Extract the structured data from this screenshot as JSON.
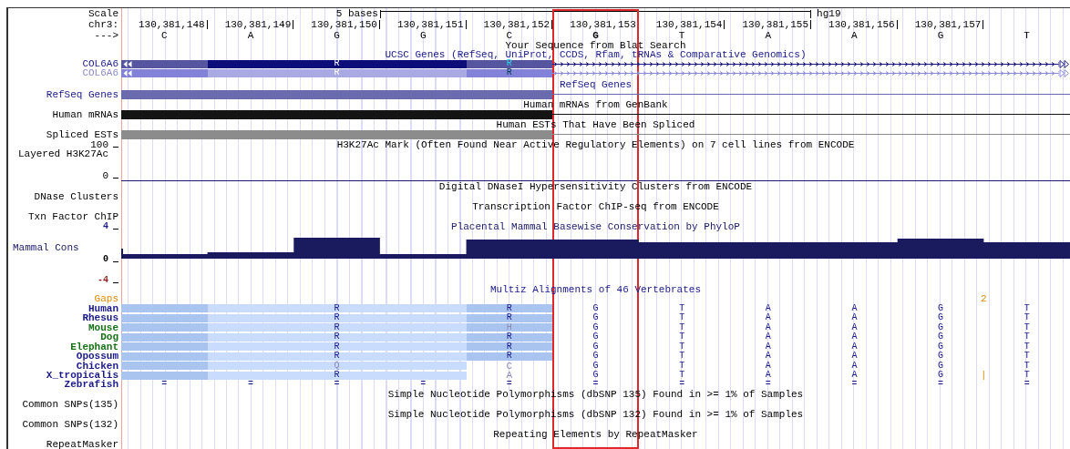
{
  "ruler": {
    "scale_label": "Scale",
    "scale_text": "5 bases",
    "assembly": "hg19",
    "chrom_label": "chr3:",
    "strand_label": "--->",
    "positions": [
      "130,381,148",
      "130,381,149",
      "130,381,150",
      "130,381,151",
      "130,381,152",
      "130,381,153",
      "130,381,154",
      "130,381,155",
      "130,381,156",
      "130,381,157"
    ],
    "bases": [
      {
        "letter": "C",
        "selected": false
      },
      {
        "letter": "A",
        "selected": false
      },
      {
        "letter": "G",
        "selected": false
      },
      {
        "letter": "G",
        "selected": false
      },
      {
        "letter": "C",
        "selected": false
      },
      {
        "letter": "G",
        "selected": true
      },
      {
        "letter": "T",
        "selected": false
      },
      {
        "letter": "A",
        "selected": false
      },
      {
        "letter": "A",
        "selected": false
      },
      {
        "letter": "G",
        "selected": false
      },
      {
        "letter": "T",
        "selected": false
      }
    ]
  },
  "tracks": [
    {
      "kind": "title",
      "title": "Your Sequence from Blat Search",
      "color": "#000000"
    },
    {
      "kind": "gene",
      "title": "UCSC Genes (RefSeq, UniProt, CCDS, Rfam, tRNAs & Comparative Genomics)",
      "color": "#1a1a8a",
      "items": [
        {
          "label": "COL6A6",
          "kind": "dark",
          "codons": [
            "R",
            "R"
          ]
        },
        {
          "label": "COL6A6",
          "kind": "light",
          "codons": [
            "R",
            "R"
          ]
        }
      ]
    },
    {
      "kind": "bar",
      "title": "RefSeq Genes",
      "label": "RefSeq Genes",
      "color": "#1a1a8a",
      "bar": {
        "color": "#6a6aae"
      }
    },
    {
      "kind": "bar",
      "title": "Human mRNAs from GenBank",
      "label": "Human mRNAs",
      "color": "#000000",
      "bar": {
        "color": "#141414"
      }
    },
    {
      "kind": "bar",
      "title": "Human ESTs That Have Been Spliced",
      "label": "Spliced ESTs",
      "color": "#000000",
      "bar": {
        "color": "#8c8c8c"
      }
    },
    {
      "kind": "signal",
      "title": "H3K27Ac Mark (Often Found Near Active Regulatory Elements) on 7 cell lines from ENCODE",
      "label": "Layered H3K27Ac",
      "color": "#000000",
      "axis": [
        "100",
        "0"
      ]
    },
    {
      "kind": "dense",
      "title": "Digital DNaseI Hypersensitivity Clusters from ENCODE",
      "label": "DNase Clusters",
      "color": "#000000"
    },
    {
      "kind": "dense",
      "title": "Transcription Factor ChIP-seq from ENCODE",
      "label": "Txn Factor ChIP",
      "color": "#000000"
    },
    {
      "kind": "wiggle",
      "title": "Placental Mammal Basewise Conservation by PhyloP",
      "label": "Mammal Cons",
      "color": "#1a1a6a",
      "axis": [
        {
          "text": "4",
          "color": "#1a1a8a"
        },
        {
          "text": "0",
          "color": "#000000"
        },
        {
          "text": "-4",
          "color": "#8b1a1a"
        }
      ]
    },
    {
      "kind": "multiz",
      "title": "Multiz Alignments of 46 Vertebrates",
      "color": "#1a1a8a",
      "gaps": {
        "label": "Gaps",
        "color": "#e08a00",
        "count": "2"
      },
      "species": [
        {
          "name": "Human",
          "color": "#1a1a8a",
          "codons": [
            {
              "aa": "R",
              "block": true,
              "differs": false
            },
            {
              "aa": "R",
              "block": true,
              "differs": false
            }
          ],
          "bases": [
            "G",
            "T",
            "A",
            "A",
            "G",
            "T"
          ]
        },
        {
          "name": "Rhesus",
          "color": "#1a1a8a",
          "codons": [
            {
              "aa": "R",
              "block": true,
              "differs": false
            },
            {
              "aa": "R",
              "block": true,
              "differs": false
            }
          ],
          "bases": [
            "G",
            "T",
            "A",
            "A",
            "G",
            "T"
          ]
        },
        {
          "name": "Mouse",
          "color": "#157015",
          "codons": [
            {
              "aa": "R",
              "block": true,
              "differs": false
            },
            {
              "aa": "H",
              "block": true,
              "differs": true
            }
          ],
          "bases": [
            "G",
            "T",
            "A",
            "A",
            "G",
            "T"
          ]
        },
        {
          "name": "Dog",
          "color": "#157015",
          "codons": [
            {
              "aa": "R",
              "block": true,
              "differs": false
            },
            {
              "aa": "R",
              "block": true,
              "differs": false
            }
          ],
          "bases": [
            "G",
            "T",
            "A",
            "A",
            "G",
            "T"
          ]
        },
        {
          "name": "Elephant",
          "color": "#157015",
          "codons": [
            {
              "aa": "R",
              "block": true,
              "differs": false
            },
            {
              "aa": "R",
              "block": true,
              "differs": false
            }
          ],
          "bases": [
            "G",
            "T",
            "A",
            "A",
            "G",
            "T"
          ]
        },
        {
          "name": "Opossum",
          "color": "#1a1a8a",
          "codons": [
            {
              "aa": "R",
              "block": true,
              "differs": false
            },
            {
              "aa": "R",
              "block": true,
              "differs": false
            }
          ],
          "bases": [
            "G",
            "T",
            "A",
            "A",
            "G",
            "T"
          ]
        },
        {
          "name": "Chicken",
          "color": "#1a1a8a",
          "codons": [
            {
              "aa": "Q",
              "block": true,
              "differs": true
            },
            {
              "aa": "C",
              "block": false,
              "differs": true
            }
          ],
          "bases": [
            "G",
            "T",
            "A",
            "A",
            "G",
            "T"
          ]
        },
        {
          "name": "X_tropicalis",
          "color": "#1a1a8a",
          "codons": [
            {
              "aa": "R",
              "block": true,
              "differs": false
            },
            {
              "aa": "A",
              "block": false,
              "differs": true
            }
          ],
          "bases": [
            "G",
            "T",
            "A",
            "A",
            "G",
            "T"
          ],
          "insert": "|"
        },
        {
          "name": "Zebrafish",
          "color": "#1a1a8a",
          "bases": [
            "=",
            "=",
            "=",
            "=",
            "=",
            "=",
            "=",
            "=",
            "=",
            "=",
            "="
          ]
        }
      ]
    },
    {
      "kind": "dense",
      "title": "Simple Nucleotide Polymorphisms (dbSNP 135) Found in >= 1% of Samples",
      "label": "Common SNPs(135)",
      "color": "#000000"
    },
    {
      "kind": "dense",
      "title": "Simple Nucleotide Polymorphisms (dbSNP 132) Found in >= 1% of Samples",
      "label": "Common SNPs(132)",
      "color": "#000000"
    },
    {
      "kind": "dense",
      "title": "Repeating Elements by RepeatMasker",
      "label": "RepeatMasker",
      "color": "#000000"
    }
  ]
}
